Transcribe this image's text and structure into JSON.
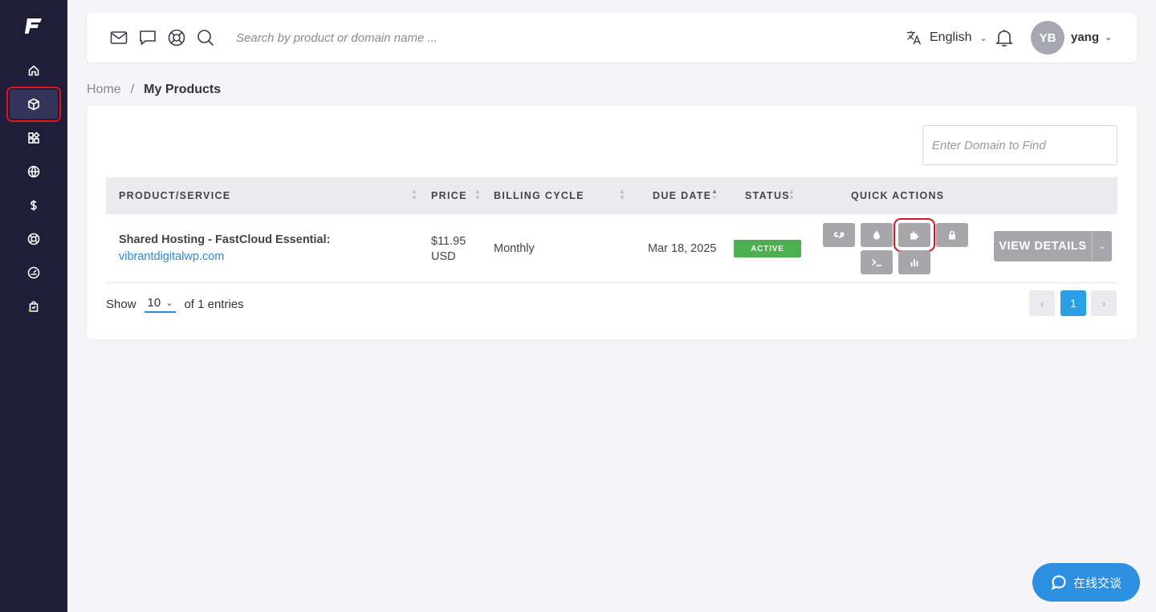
{
  "sidebar": {
    "logo": "fastcomet-logo",
    "items": [
      {
        "name": "home",
        "icon": "home-icon",
        "active": false
      },
      {
        "name": "products",
        "icon": "box-icon",
        "active": true
      },
      {
        "name": "addons",
        "icon": "grid-icon",
        "active": false
      },
      {
        "name": "domains",
        "icon": "globe-icon",
        "active": false
      },
      {
        "name": "billing",
        "icon": "dollar-icon",
        "active": false
      },
      {
        "name": "support",
        "icon": "lifebuoy-icon",
        "active": false
      },
      {
        "name": "affiliate",
        "icon": "gauge-icon",
        "active": false
      },
      {
        "name": "store",
        "icon": "shopping-bag-star-icon",
        "active": false
      }
    ]
  },
  "topbar": {
    "icons": [
      "mail-icon",
      "chat-bubble-icon",
      "lifebuoy-icon",
      "search-icon"
    ],
    "search_placeholder": "Search by product or domain name ...",
    "language": "English",
    "avatar_initials": "YB",
    "username": "yang"
  },
  "breadcrumb": {
    "home": "Home",
    "separator": "/",
    "current": "My Products"
  },
  "table": {
    "domain_search_placeholder": "Enter Domain to Find",
    "headers": {
      "product": "PRODUCT/SERVICE",
      "price": "PRICE",
      "billing": "BILLING CYCLE",
      "due": "DUE DATE",
      "status": "STATUS",
      "actions": "QUICK ACTIONS"
    },
    "rows": [
      {
        "product": "Shared Hosting - FastCloud Essential:",
        "domain": "vibrantdigitalwp.com",
        "price_amount": "$11.95",
        "price_currency": "USD",
        "billing_cycle": "Monthly",
        "due_date": "Mar 18, 2025",
        "status": "ACTIVE",
        "quick_actions": [
          "cpanel-icon",
          "drop-icon",
          "puzzle-icon",
          "lock-icon",
          "terminal-icon",
          "bar-chart-icon"
        ],
        "view_details": "VIEW DETAILS"
      }
    ],
    "footer": {
      "show_label": "Show",
      "show_value": "10",
      "entries_text": "of 1 entries",
      "prev": "‹",
      "current_page": "1",
      "next": "›"
    }
  },
  "chat": {
    "label": "在线交谈"
  },
  "colors": {
    "sidebar_bg": "#1f1d38",
    "accent": "#2a9fe6",
    "status_active": "#4caf50",
    "action_button": "#a6a6ab",
    "highlight": "#e0121b"
  }
}
